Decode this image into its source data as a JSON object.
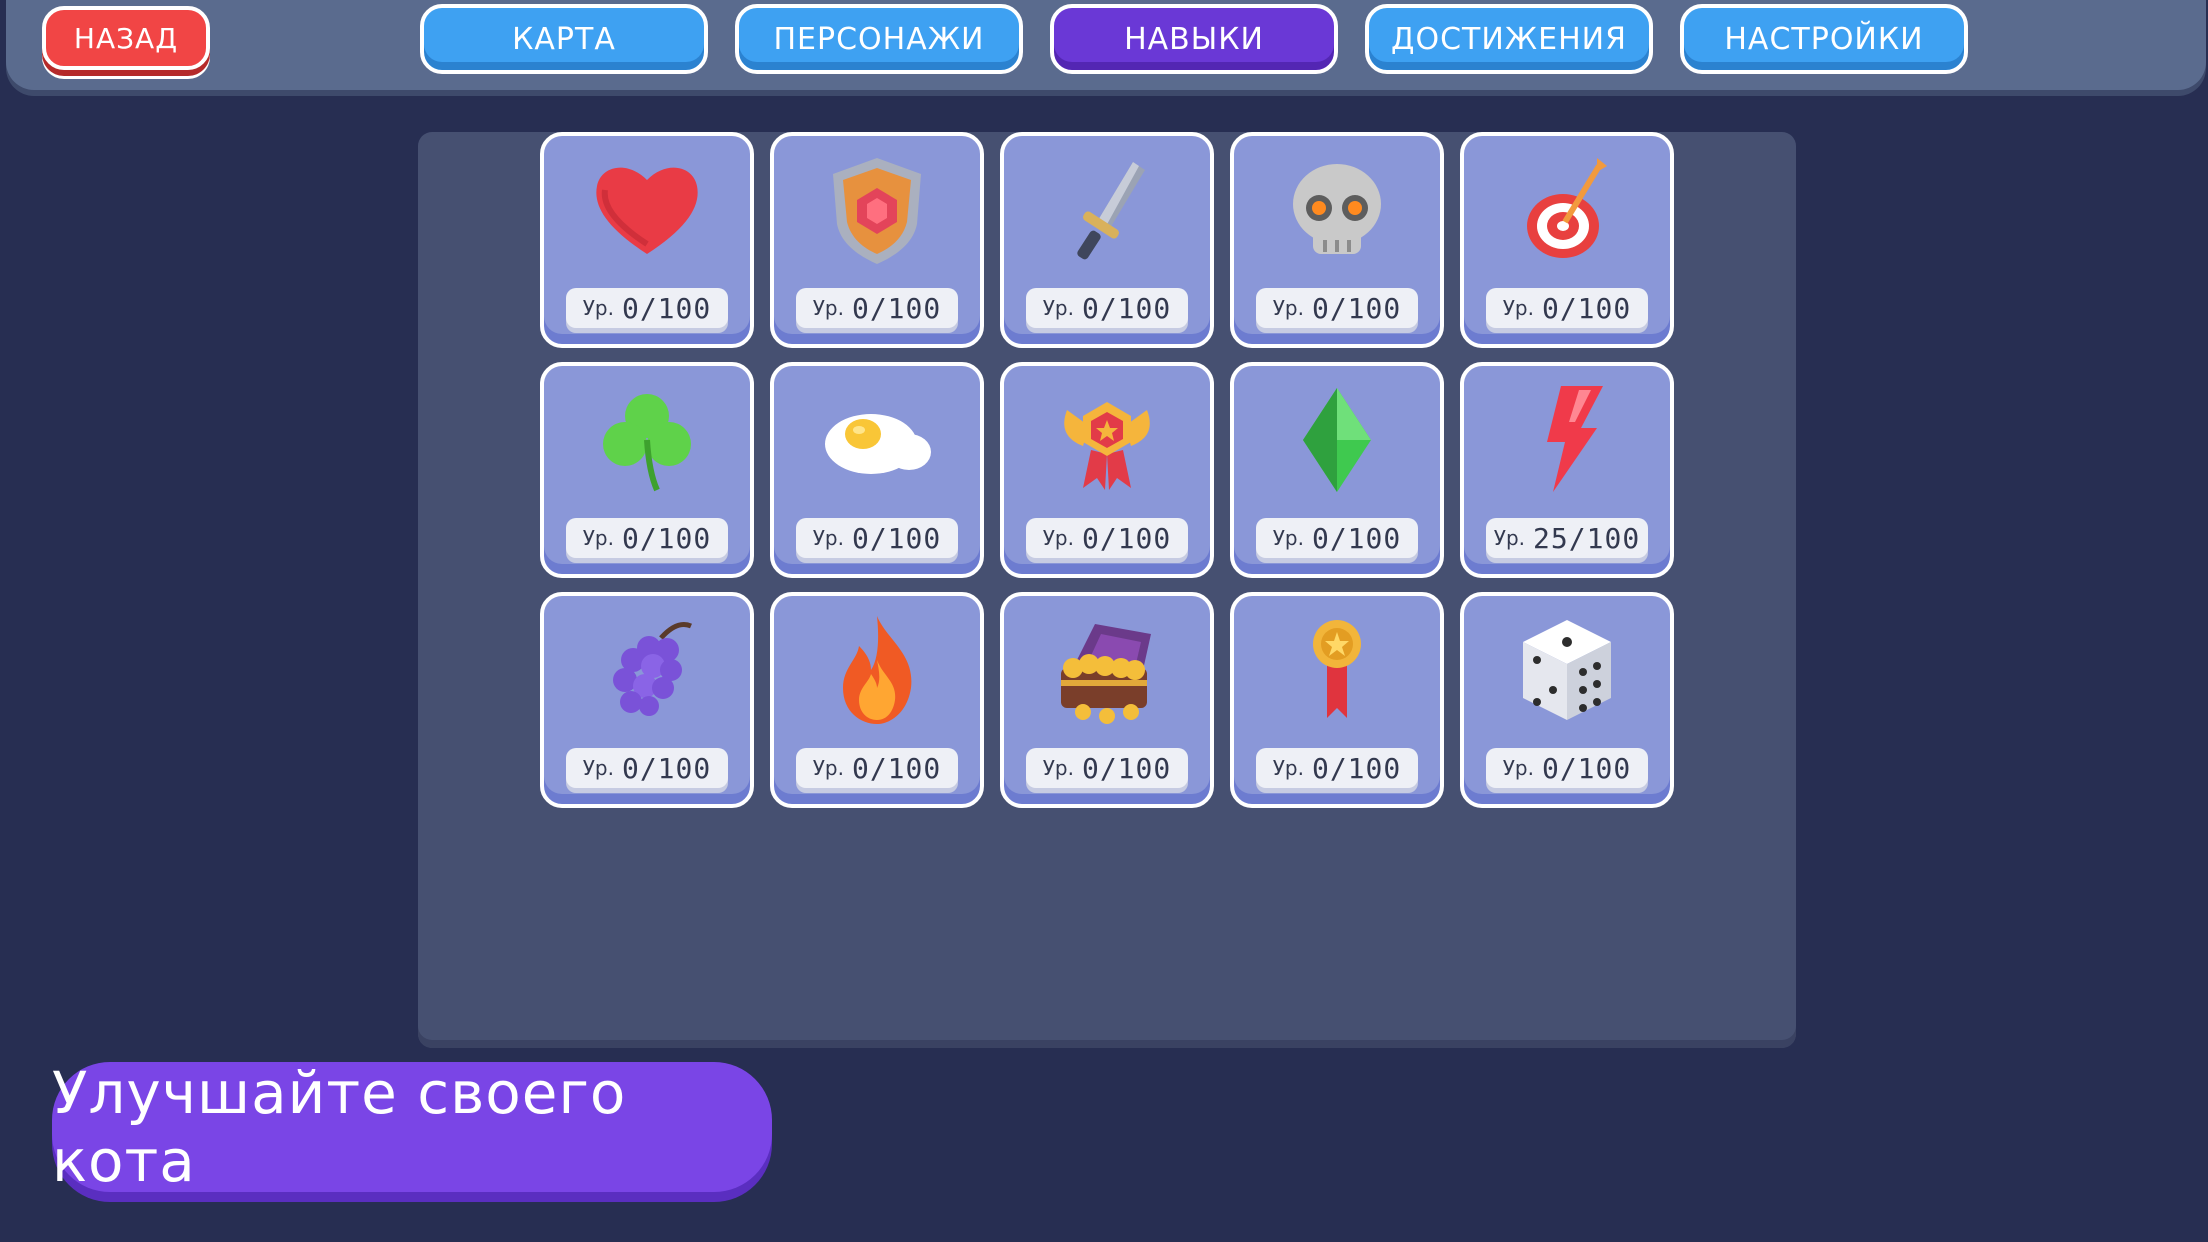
{
  "header": {
    "back_label": "НАЗАД",
    "tabs": [
      {
        "label": "КАРТА"
      },
      {
        "label": "ПЕРСОНАЖИ"
      },
      {
        "label": "НАВЫКИ"
      },
      {
        "label": "ДОСТИЖЕНИЯ"
      },
      {
        "label": "НАСТРОЙКИ"
      }
    ],
    "active_tab": "НАВЫКИ"
  },
  "skills": {
    "level_prefix": "Ур.",
    "items": [
      {
        "icon": "heart-icon",
        "level": "0/100"
      },
      {
        "icon": "shield-icon",
        "level": "0/100"
      },
      {
        "icon": "sword-icon",
        "level": "0/100"
      },
      {
        "icon": "skull-icon",
        "level": "0/100"
      },
      {
        "icon": "target-icon",
        "level": "0/100"
      },
      {
        "icon": "clover-icon",
        "level": "0/100"
      },
      {
        "icon": "fried-egg-icon",
        "level": "0/100"
      },
      {
        "icon": "winged-badge-icon",
        "level": "0/100"
      },
      {
        "icon": "green-gem-icon",
        "level": "0/100"
      },
      {
        "icon": "lightning-icon",
        "level": "25/100"
      },
      {
        "icon": "grapes-icon",
        "level": "0/100"
      },
      {
        "icon": "fire-icon",
        "level": "0/100"
      },
      {
        "icon": "treasure-chest-icon",
        "level": "0/100"
      },
      {
        "icon": "medal-ribbon-icon",
        "level": "0/100"
      },
      {
        "icon": "dice-icon",
        "level": "0/100"
      }
    ]
  },
  "footer": {
    "banner_text": "Улучшайте своего кота"
  },
  "colors": {
    "background": "#272e52",
    "tab_blue": "#3ea1f2",
    "tab_active_purple": "#6a38d6",
    "back_red": "#f14545",
    "card_fill": "#8a97d8",
    "banner_purple": "#7a45e6"
  }
}
